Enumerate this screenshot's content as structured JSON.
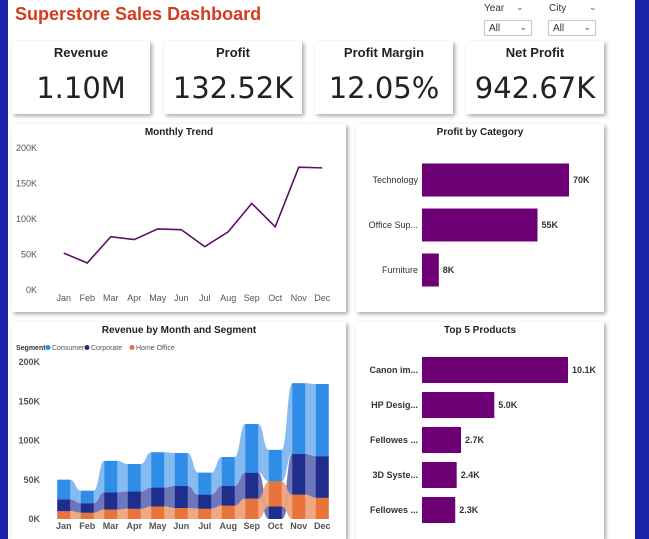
{
  "header": {
    "title": "Superstore Sales Dashboard"
  },
  "filters": {
    "year": {
      "label": "Year",
      "value": "All"
    },
    "city": {
      "label": "City",
      "value": "All"
    }
  },
  "kpis": [
    {
      "label": "Revenue",
      "value": "1.10M"
    },
    {
      "label": "Profit",
      "value": "132.52K"
    },
    {
      "label": "Profit Margin",
      "value": "12.05%"
    },
    {
      "label": "Net Profit",
      "value": "942.67K"
    }
  ],
  "colors": {
    "line": "#5b1166",
    "bar": "#6e0075",
    "consumer": "#2f8de8",
    "corporate": "#1f2e8c",
    "home_office": "#e8743c",
    "title": "#d63b1f"
  },
  "chart_data": [
    {
      "type": "line",
      "title": "Monthly Trend",
      "categories": [
        "Jan",
        "Feb",
        "Mar",
        "Apr",
        "May",
        "Jun",
        "Jul",
        "Aug",
        "Sep",
        "Oct",
        "Nov",
        "Dec"
      ],
      "values": [
        52000,
        38000,
        75000,
        71000,
        86000,
        85000,
        61000,
        82000,
        122000,
        89000,
        173000,
        172000
      ],
      "ylim": [
        0,
        200000
      ],
      "yticks": [
        "0K",
        "50K",
        "100K",
        "150K",
        "200K"
      ]
    },
    {
      "type": "bar",
      "orientation": "horizontal",
      "title": "Profit by Category",
      "categories": [
        "Technology",
        "Office Sup...",
        "Furniture"
      ],
      "values": [
        70000,
        55000,
        8000
      ],
      "labels": [
        "70K",
        "55K",
        "8K"
      ]
    },
    {
      "type": "area",
      "title": "Revenue by Month and Segment",
      "legend_title": "Segment",
      "legend_placement": "top-left",
      "categories": [
        "Jan",
        "Feb",
        "Mar",
        "Apr",
        "May",
        "Jun",
        "Jul",
        "Aug",
        "Sep",
        "Oct",
        "Nov",
        "Dec"
      ],
      "ylim": [
        0,
        200000
      ],
      "yticks": [
        "0K",
        "50K",
        "100K",
        "150K",
        "200K"
      ],
      "series": [
        {
          "name": "Consumer",
          "values": [
            25000,
            16000,
            40000,
            35000,
            45000,
            42000,
            28000,
            37000,
            62000,
            40000,
            90000,
            92000
          ]
        },
        {
          "name": "Corporate",
          "values": [
            15000,
            12000,
            22000,
            22000,
            24000,
            28000,
            18000,
            25000,
            33000,
            16000,
            52000,
            53000
          ]
        },
        {
          "name": "Home Office",
          "values": [
            10000,
            8000,
            12000,
            13000,
            16000,
            14000,
            13000,
            17000,
            26000,
            32000,
            31000,
            27000
          ]
        }
      ]
    },
    {
      "type": "bar",
      "orientation": "horizontal",
      "title": "Top 5 Products",
      "categories": [
        "Canon im...",
        "HP Desig...",
        "Fellowes ...",
        "3D Syste...",
        "Fellowes ..."
      ],
      "values": [
        10100,
        5000,
        2700,
        2400,
        2300
      ],
      "labels": [
        "10.1K",
        "5.0K",
        "2.7K",
        "2.4K",
        "2.3K"
      ]
    }
  ]
}
